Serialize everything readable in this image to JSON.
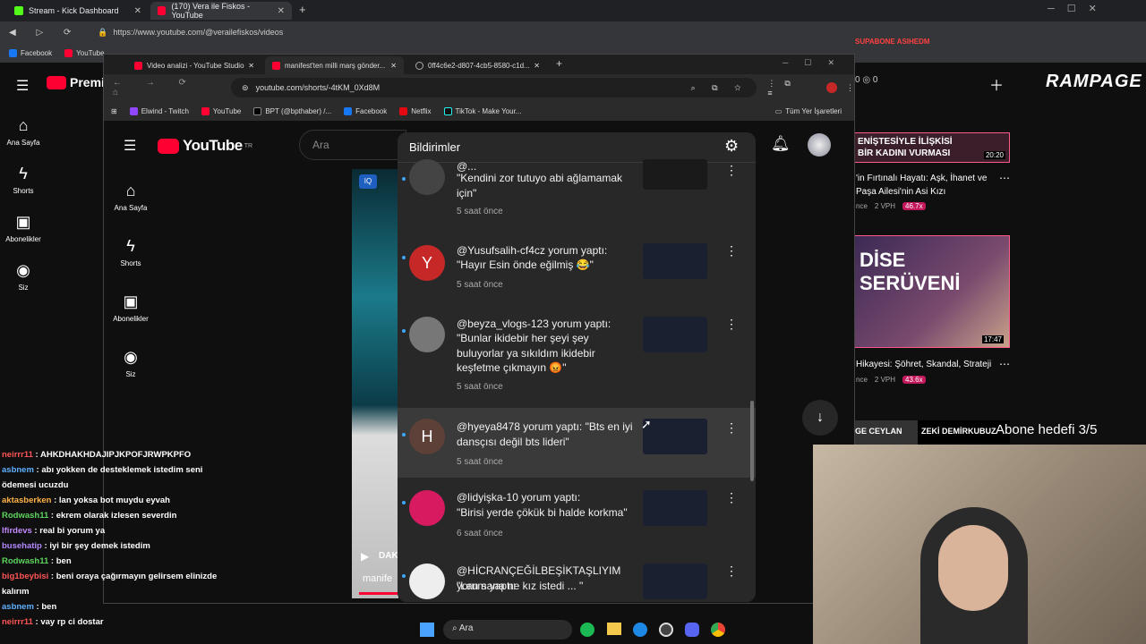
{
  "outer_browser": {
    "tabs": [
      {
        "label": "Stream - Kick Dashboard",
        "color": "#53fc18"
      },
      {
        "label": "(170) Vera ile Fiskos - YouTube",
        "color": "#ff0033"
      }
    ],
    "url": "https://www.youtube.com/@verailefiskos/videos",
    "bookmarks": [
      "Facebook",
      "YouTube"
    ]
  },
  "bg_channel": {
    "brand": "Premium",
    "nav": [
      "Ana Sayfa",
      "Shorts",
      "Abonelikler",
      "Siz"
    ],
    "videos": [
      {
        "title": "'in Fırtınalı Hayatı: Aşk, İhanet ve Paşa Ailesi'nin Asi Kızı",
        "thumb_text": "ENİŞTESİYLE İLİŞKİSİ BİR KADINI VURMASI",
        "duration": "20:20",
        "meta": "nce",
        "views": "2 VPH",
        "badge": "46.7x"
      },
      {
        "title": "Hikayesi: Şöhret, Skandal, Strateji",
        "thumb_text": "DİSE SERÜVENİ",
        "duration": "17:47",
        "meta": "nce",
        "views": "2 VPH",
        "badge": "43.6x"
      }
    ],
    "thumb3": [
      "GE CEYLAN",
      "ZEKİ DEMİRKUBUZ"
    ],
    "top_counts": [
      "0",
      "0"
    ],
    "rampage": "RAMPAGE",
    "goal_text": "Abone hedefi 3/5",
    "promo_text": "SUPABONE ASIHEDM"
  },
  "inner_browser": {
    "tabs": [
      {
        "label": "Video analizi - YouTube Studio"
      },
      {
        "label": "manifest'ten milli marş gönder..."
      },
      {
        "label": "0ff4c6e2-d807-4cb5-8580-c1d..."
      }
    ],
    "url": "youtube.com/shorts/-4tKM_0Xd8M",
    "bookmarks": [
      "Elwind - Twitch",
      "YouTube",
      "BPT (@bpthaber) /...",
      "Facebook",
      "Netflix",
      "TikTok - Make Your..."
    ],
    "all_bookmarks": "Tüm Yer İşaretleri"
  },
  "youtube": {
    "logo": "YouTube",
    "region": "TR",
    "search_placeholder": "Ara",
    "nav": [
      "Ana Sayfa",
      "Shorts",
      "Abonelikler",
      "Siz"
    ],
    "short_caption": "manife",
    "short_overlay": "DAK"
  },
  "notifications": {
    "title": "Bildirimler",
    "items": [
      {
        "user": "@...",
        "text": "\"Kendini zor tutuyo abi ağlamamak için\"",
        "time": "5 saat önce",
        "avatar": "",
        "avatar_color": "#444"
      },
      {
        "user": "@Yusufsalih-cf4cz yorum yaptı:",
        "text": "\"Hayır Esin önde eğilmiş 😂\"",
        "time": "5 saat önce",
        "avatar": "Y",
        "avatar_color": "#c62828"
      },
      {
        "user": "@beyza_vlogs-123 yorum yaptı:",
        "text": "\"Bunlar ikidebir her şeyi şey buluyorlar ya sıkıldım ikidebir keşfetme çıkmayın 😡\"",
        "time": "5 saat önce",
        "avatar": "",
        "avatar_color": "#777"
      },
      {
        "user": "@hyeya8478 yorum yaptı:",
        "text": "\"Bts en iyi dansçısı değil bts lideri\"",
        "time": "5 saat önce",
        "avatar": "H",
        "avatar_color": "#5d4037"
      },
      {
        "user": "@lidyişka-10 yorum yaptı:",
        "text": "\"Birisi yerde çökük bi halde korkma\"",
        "time": "6 saat önce",
        "avatar": "",
        "avatar_color": "#d81b60"
      },
      {
        "user": "@HİCRANÇEĞİLBEŞİKTAŞLIYIM yorum yaptı:",
        "text": "\"Lan sana ne kız istedi ... \"",
        "time": "",
        "avatar": "",
        "avatar_color": "#eee"
      }
    ]
  },
  "chat": [
    {
      "user": "neirrr11",
      "msg": "AHKDHAKHDAJIPJKPOFJRWPKPFO",
      "color": "#ff5555"
    },
    {
      "user": "asbnem",
      "msg": "abı yokken de desteklemek istedim seni ödemesi ucuzdu",
      "color": "#5fb0ff"
    },
    {
      "user": "aktasberken",
      "msg": "lan yoksa bot muydu eyvah",
      "color": "#ffb347"
    },
    {
      "user": "Rodwash11",
      "msg": "ekrem olarak izlesen severdin",
      "color": "#5dd55d"
    },
    {
      "user": "lfirdevs",
      "msg": "real bi yorum ya",
      "color": "#c38bff"
    },
    {
      "user": "busehatip",
      "msg": "iyi bir şey demek istedim",
      "color": "#b388ff"
    },
    {
      "user": "Rodwash11",
      "msg": "ben",
      "color": "#5dd55d"
    },
    {
      "user": "big1beybisi",
      "msg": "beni oraya çağırmayın gelirsem elinizde kalırım",
      "color": "#ff5555"
    },
    {
      "user": "asbnem",
      "msg": "ben",
      "color": "#5fb0ff"
    },
    {
      "user": "neirrr11",
      "msg": "vay rp ci dostar",
      "color": "#ff5555"
    }
  ],
  "taskbar": {
    "search": "Ara"
  }
}
